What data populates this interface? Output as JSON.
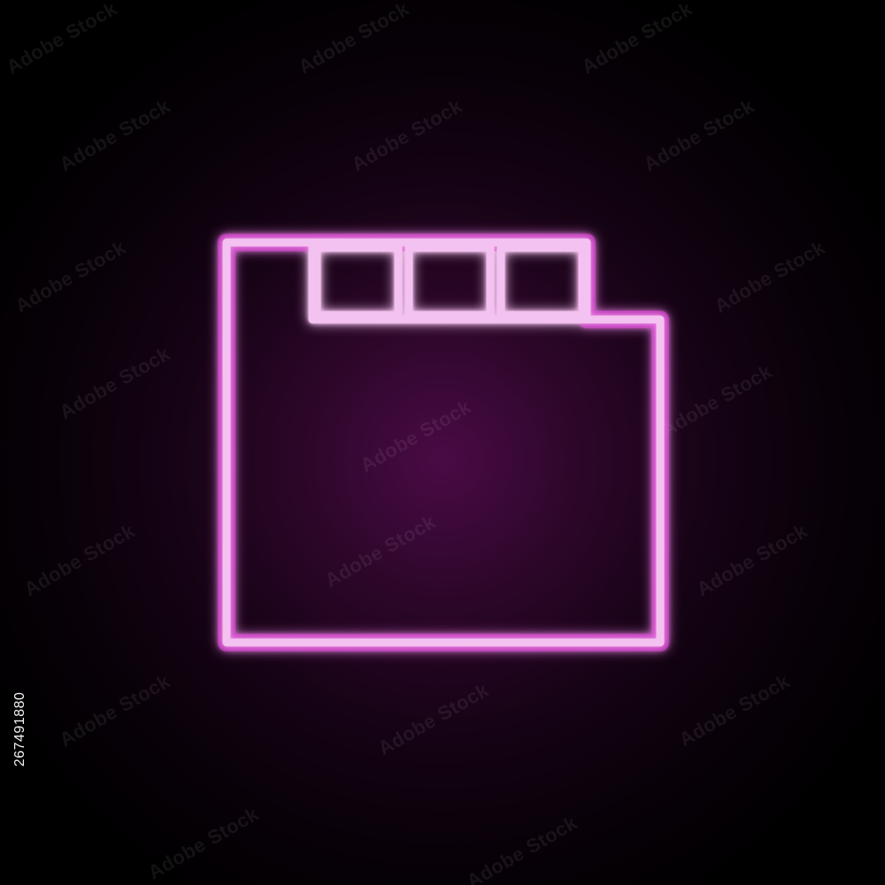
{
  "icon": {
    "name": "memory-card-icon",
    "stroke_color": "#f4c2f0",
    "glow_color": "#e040d8",
    "background_center": "#4a0b45",
    "background_edge": "#000000"
  },
  "watermark": {
    "text": "Adobe Stock"
  },
  "stock_id": "267491880"
}
